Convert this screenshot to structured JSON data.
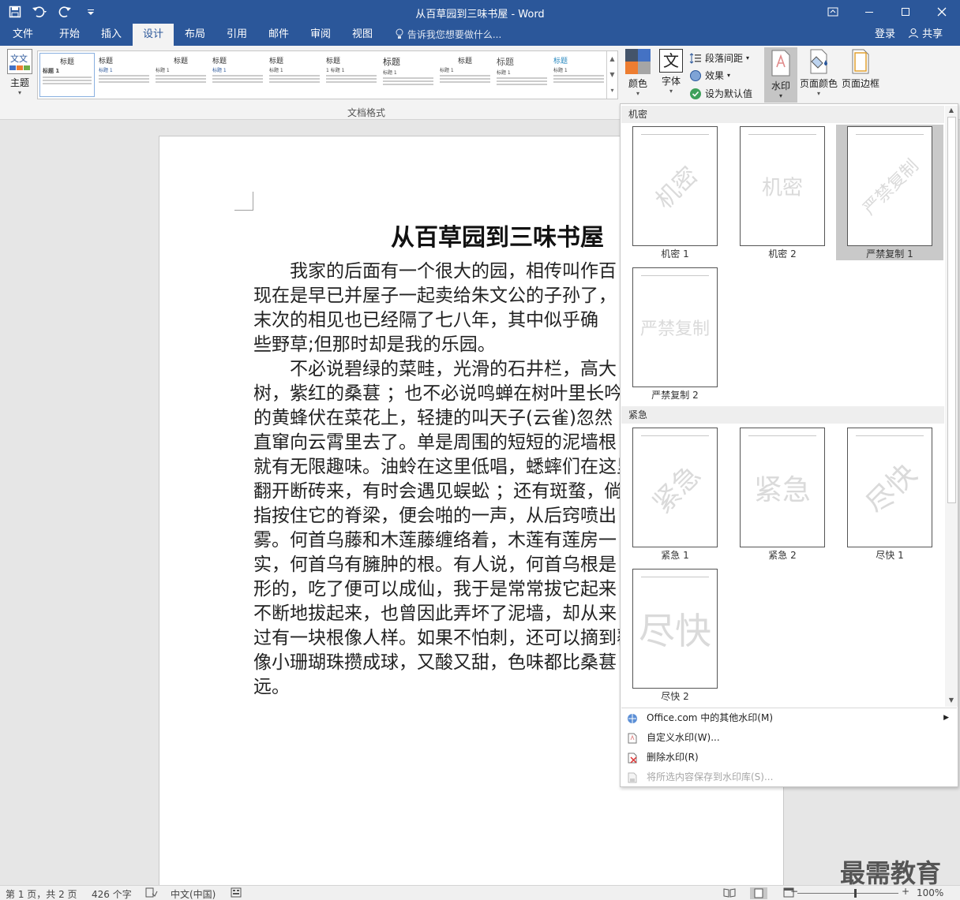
{
  "window": {
    "title": "从百草园到三味书屋 - Word",
    "qat": {
      "save_icon": "save-icon",
      "undo_icon": "undo-icon",
      "redo_icon": "redo-icon",
      "customize_icon": "customize-icon"
    }
  },
  "tabs": [
    {
      "label": "文件"
    },
    {
      "label": "开始"
    },
    {
      "label": "插入"
    },
    {
      "label": "设计",
      "active": true
    },
    {
      "label": "布局"
    },
    {
      "label": "引用"
    },
    {
      "label": "邮件"
    },
    {
      "label": "审阅"
    },
    {
      "label": "视图"
    }
  ],
  "tellme": "告诉我您想要做什么...",
  "account": {
    "login": "登录",
    "share": "共享"
  },
  "ribbon": {
    "theme_label": "主题",
    "theme_icon_text": "文文",
    "gallery": [
      {
        "title": "标题",
        "line": "标题 1"
      },
      {
        "title": "标题",
        "line": "标题 1"
      },
      {
        "title": "标题",
        "line": "标题 1"
      },
      {
        "title": "标题",
        "line": "标题 1"
      },
      {
        "title": "标题",
        "line": "标题 1"
      },
      {
        "title": "标题",
        "line": "1 标题 1"
      },
      {
        "title": "标题",
        "line": "标题 1"
      },
      {
        "title": "标题",
        "line": "标题 1"
      },
      {
        "title": "标题",
        "line": "标题 1"
      },
      {
        "title": "标题",
        "line": "标题 1"
      }
    ],
    "group_label": "文档格式",
    "colors_label": "颜色",
    "fonts_label": "字体",
    "fonts_icon_text": "文",
    "para_spacing_label": "段落间距",
    "effects_label": "效果",
    "set_default_label": "设为默认值",
    "watermark_label": "水印",
    "page_color_label": "页面颜色",
    "page_border_label": "页面边框"
  },
  "document": {
    "title": "从百草园到三味书屋",
    "lines": [
      "　　我家的后面有一个很大的园，相传叫作百",
      "现在是早已并屋子一起卖给朱文公的子孙了，",
      "末次的相见也已经隔了七八年，其中似乎确",
      "些野草;但那时却是我的乐园。",
      "　　不必说碧绿的菜畦，光滑的石井栏，高大",
      "树，紫红的桑葚 ；也不必说鸣蝉在树叶里长吟",
      "的黄蜂伏在菜花上，轻捷的叫天子(云雀)忽然",
      "直窜向云霄里去了。单是周围的短短的泥墙根",
      "就有无限趣味。油蛉在这里低唱，蟋蟀们在这里",
      "翻开断砖来，有时会遇见蜈蚣 ；还有斑蝥，倘",
      "指按住它的脊梁，便会啪的一声，从后窍喷出",
      "雾。何首乌藤和木莲藤缠络着，木莲有莲房一",
      "实，何首乌有臃肿的根。有人说，何首乌根是",
      "形的，吃了便可以成仙，我于是常常拔它起来",
      "不断地拔起来，也曾因此弄坏了泥墙，却从来",
      "过有一块根像人样。如果不怕刺，还可以摘到覆",
      "像小珊瑚珠攒成球，又酸又甜，色味都比桑葚",
      "远。"
    ]
  },
  "watermark_panel": {
    "sections": [
      {
        "header": "机密",
        "items": [
          {
            "caption": "机密 1",
            "text": "机密",
            "style": "diagonal"
          },
          {
            "caption": "机密 2",
            "text": "机密",
            "style": "horizontal"
          },
          {
            "caption": "严禁复制 1",
            "text": "严禁复制",
            "style": "diagonal",
            "selected": true
          },
          {
            "caption": "严禁复制 2",
            "text": "严禁复制",
            "style": "horizontal"
          }
        ]
      },
      {
        "header": "紧急",
        "items": [
          {
            "caption": "紧急 1",
            "text": "紧急",
            "style": "diagonal"
          },
          {
            "caption": "紧急 2",
            "text": "紧急",
            "style": "horizontal"
          },
          {
            "caption": "尽快 1",
            "text": "尽快",
            "style": "diagonal"
          },
          {
            "caption": "尽快 2",
            "text": "尽快",
            "style": "horizontal"
          }
        ]
      }
    ],
    "menu": [
      {
        "label": "Office.com 中的其他水印(M)",
        "icon": "office-icon",
        "submenu": true,
        "enabled": true
      },
      {
        "label": "自定义水印(W)...",
        "icon": "custom-watermark-icon",
        "enabled": true
      },
      {
        "label": "删除水印(R)",
        "icon": "remove-watermark-icon",
        "enabled": true
      },
      {
        "label": "将所选内容保存到水印库(S)...",
        "icon": "save-to-gallery-icon",
        "enabled": false
      }
    ]
  },
  "status": {
    "page": "第 1 页，共 2 页",
    "words": "426 个字",
    "language": "中文(中国)",
    "zoom": "100%",
    "zoom_percent": 100
  },
  "brand": "最需教育",
  "colors": {
    "titlebar": "#2b579a",
    "ribbon": "#f3f3f3",
    "selected_tile": "#c9c9c9",
    "watermark_text": "#dadada"
  }
}
